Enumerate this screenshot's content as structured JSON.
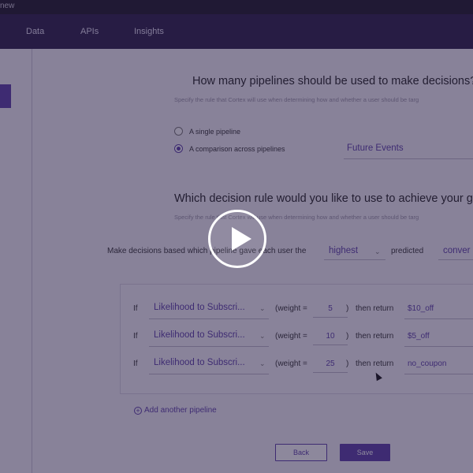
{
  "window": {
    "title_fragment": "new"
  },
  "nav": {
    "items": [
      "Data",
      "APIs",
      "Insights"
    ]
  },
  "section1": {
    "question": "How many pipelines should be used to make decisions?",
    "subtext": "Specify the rule that Cortex will use when determining how and whether a user should be targ",
    "options": [
      {
        "label": "A single pipeline",
        "selected": false
      },
      {
        "label": "A comparison across pipelines",
        "selected": true
      }
    ],
    "event_select": "Future Events"
  },
  "section2": {
    "question": "Which decision rule would you like to use to achieve your goal",
    "subtext": "Specify the rule that Cortex will use when determining how and whether a user should be targ",
    "sentence_prefix": "Make decisions based which pipeline gave each user the",
    "sentence_value": "highest",
    "sentence_mid": "predicted",
    "sentence_trailing": "conver"
  },
  "rules": {
    "if_label": "If",
    "weight_open": "(weight =",
    "weight_close": ")",
    "then_label": "then return",
    "rows": [
      {
        "pipeline": "Likelihood to Subscri...",
        "weight": "5",
        "return": "$10_off"
      },
      {
        "pipeline": "Likelihood to Subscri...",
        "weight": "10",
        "return": "$5_off"
      },
      {
        "pipeline": "Likelihood to Subscri...",
        "weight": "25",
        "return": "no_coupon"
      }
    ]
  },
  "actions": {
    "add_pipeline": "Add another pipeline",
    "back": "Back",
    "save": "Save"
  },
  "colors": {
    "accent": "#5a3ea8",
    "nav_bg": "#2a1f48",
    "overlay": "#241a42"
  },
  "icons": {
    "info": "info-icon",
    "play": "play-icon",
    "plus": "plus-circle-icon",
    "chevron": "chevron-down-icon",
    "cursor": "mouse-pointer-icon"
  }
}
